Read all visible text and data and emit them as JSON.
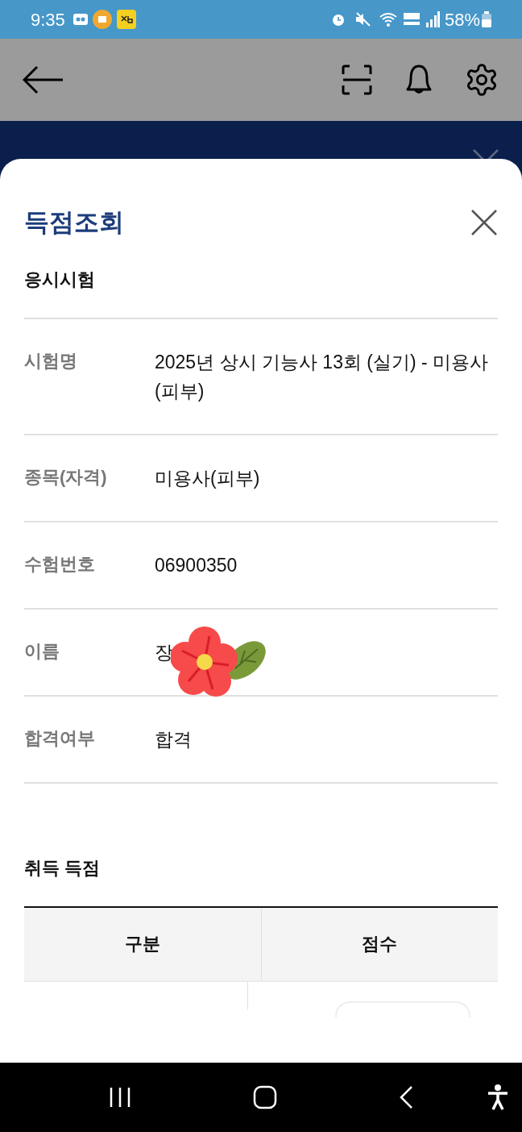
{
  "status_bar": {
    "time": "9:35",
    "battery": "58%"
  },
  "sheet": {
    "title": "득점조회",
    "section1": "응시시험",
    "fields": [
      {
        "label": "시험명",
        "value": "2025년 상시 기능사 13회 (실기) - 미용사(피부)"
      },
      {
        "label": "종목(자격)",
        "value": "미용사(피부)"
      },
      {
        "label": "수험번호",
        "value": "06900350"
      },
      {
        "label": "이름",
        "value": "장",
        "sticker": true
      },
      {
        "label": "합격여부",
        "value": "합격"
      }
    ],
    "section2": "취득 득점",
    "table": {
      "columns": [
        "구분",
        "점수"
      ]
    }
  }
}
